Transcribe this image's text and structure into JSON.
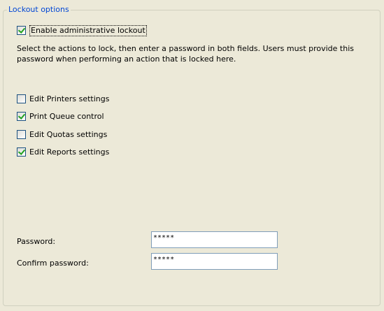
{
  "group": {
    "title": "Lockout options"
  },
  "enable_lockout": {
    "label": "Enable administrative lockout",
    "checked": true
  },
  "description": "Select the actions to lock, then enter a password in both fields. Users must provide this password when performing an action that is locked here.",
  "actions": [
    {
      "label": "Edit Printers settings",
      "checked": false
    },
    {
      "label": "Print Queue control",
      "checked": true
    },
    {
      "label": "Edit Quotas settings",
      "checked": false
    },
    {
      "label": "Edit Reports settings",
      "checked": true
    }
  ],
  "password": {
    "label": "Password:",
    "value": "*****"
  },
  "confirm_password": {
    "label": "Confirm password:",
    "value": "*****"
  },
  "colors": {
    "background": "#ece9d8",
    "group_title": "#0046d5",
    "checkmark": "#21a121",
    "checkbox_border": "#1c5180",
    "textbox_border": "#7f9db9"
  }
}
